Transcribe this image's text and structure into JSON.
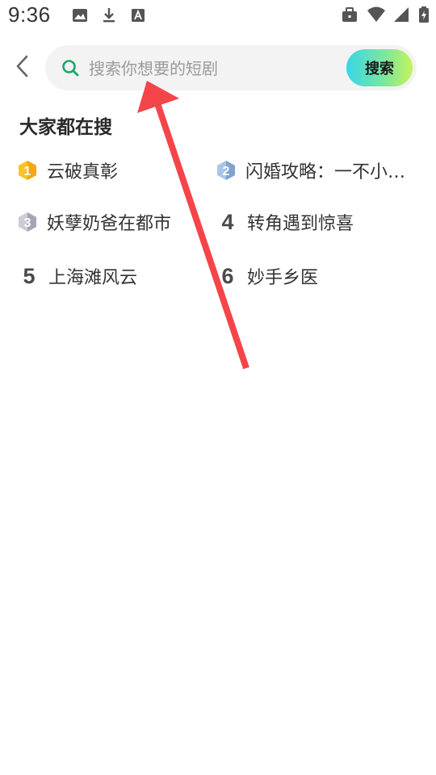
{
  "status_bar": {
    "time": "9:36",
    "icons": [
      "image-icon",
      "download-icon",
      "a-badge-icon",
      "work-briefcase-icon",
      "wifi-icon",
      "signal-icon",
      "battery-icon"
    ]
  },
  "header": {
    "back_icon": "chevron-left-icon",
    "search": {
      "placeholder": "搜索你想要的短剧",
      "value": "",
      "icon": "search-icon",
      "button_label": "搜索"
    }
  },
  "trending": {
    "title": "大家都在搜",
    "items": [
      {
        "rank": "1",
        "label": "云破真彰",
        "badge": "gold"
      },
      {
        "rank": "2",
        "label": "闪婚攻略：一不小…",
        "badge": "silver"
      },
      {
        "rank": "3",
        "label": "妖孽奶爸在都市",
        "badge": "bronze"
      },
      {
        "rank": "4",
        "label": "转角遇到惊喜",
        "badge": "number"
      },
      {
        "rank": "5",
        "label": "上海滩风云",
        "badge": "number"
      },
      {
        "rank": "6",
        "label": "妙手乡医",
        "badge": "number"
      }
    ]
  },
  "colors": {
    "accent_gradient_start": "#38d6e8",
    "accent_gradient_end": "#c6f35a",
    "search_icon": "#1aa86a",
    "annotation_arrow": "#f4454a",
    "gold_badge": "#f7c325",
    "silver_badge": "#8fb2d8",
    "bronze_badge": "#b7b3c0"
  }
}
